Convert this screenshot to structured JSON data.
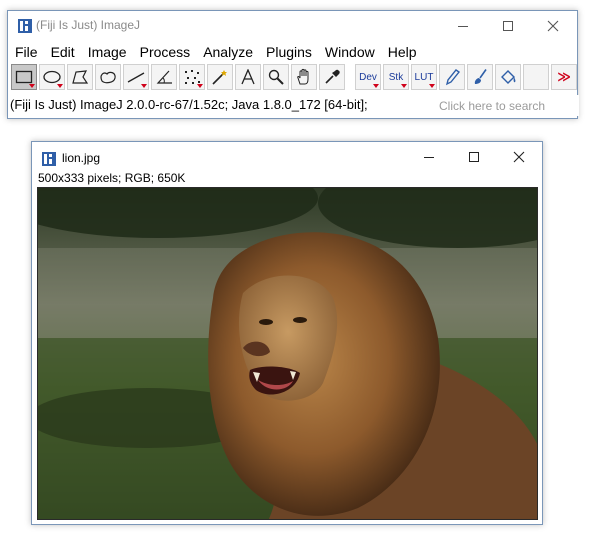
{
  "main_window": {
    "title": "(Fiji Is Just) ImageJ",
    "menu": [
      "File",
      "Edit",
      "Image",
      "Process",
      "Analyze",
      "Plugins",
      "Window",
      "Help"
    ],
    "tools": [
      {
        "name": "rectangle-tool",
        "icon": "rectangle-icon"
      },
      {
        "name": "oval-tool",
        "icon": "oval-icon"
      },
      {
        "name": "polygon-tool",
        "icon": "polygon-icon"
      },
      {
        "name": "freehand-tool",
        "icon": "freehand-icon"
      },
      {
        "name": "line-tool",
        "icon": "line-icon"
      },
      {
        "name": "angle-tool",
        "icon": "angle-icon"
      },
      {
        "name": "point-tool",
        "icon": "multipoint-icon"
      },
      {
        "name": "wand-tool",
        "icon": "wand-icon"
      },
      {
        "name": "text-tool",
        "icon": "text-A-icon"
      },
      {
        "name": "zoom-tool",
        "icon": "magnifier-icon"
      },
      {
        "name": "hand-tool",
        "icon": "hand-icon"
      },
      {
        "name": "color-picker-tool",
        "icon": "eyedropper-icon"
      }
    ],
    "toolbar_labels": {
      "dev": "Dev",
      "stk": "Stk",
      "lut": "LUT",
      "more": "≫"
    },
    "status": "(Fiji Is Just) ImageJ 2.0.0-rc-67/1.52c; Java 1.8.0_172 [64-bit];",
    "search_placeholder": "Click here to search"
  },
  "image_window": {
    "title": "lion.jpg",
    "info": "500x333 pixels; RGB; 650K"
  },
  "colors": {
    "accent": "#d0021b",
    "window_border": "#7a96b8",
    "icon_blue": "#2f5fa8"
  }
}
